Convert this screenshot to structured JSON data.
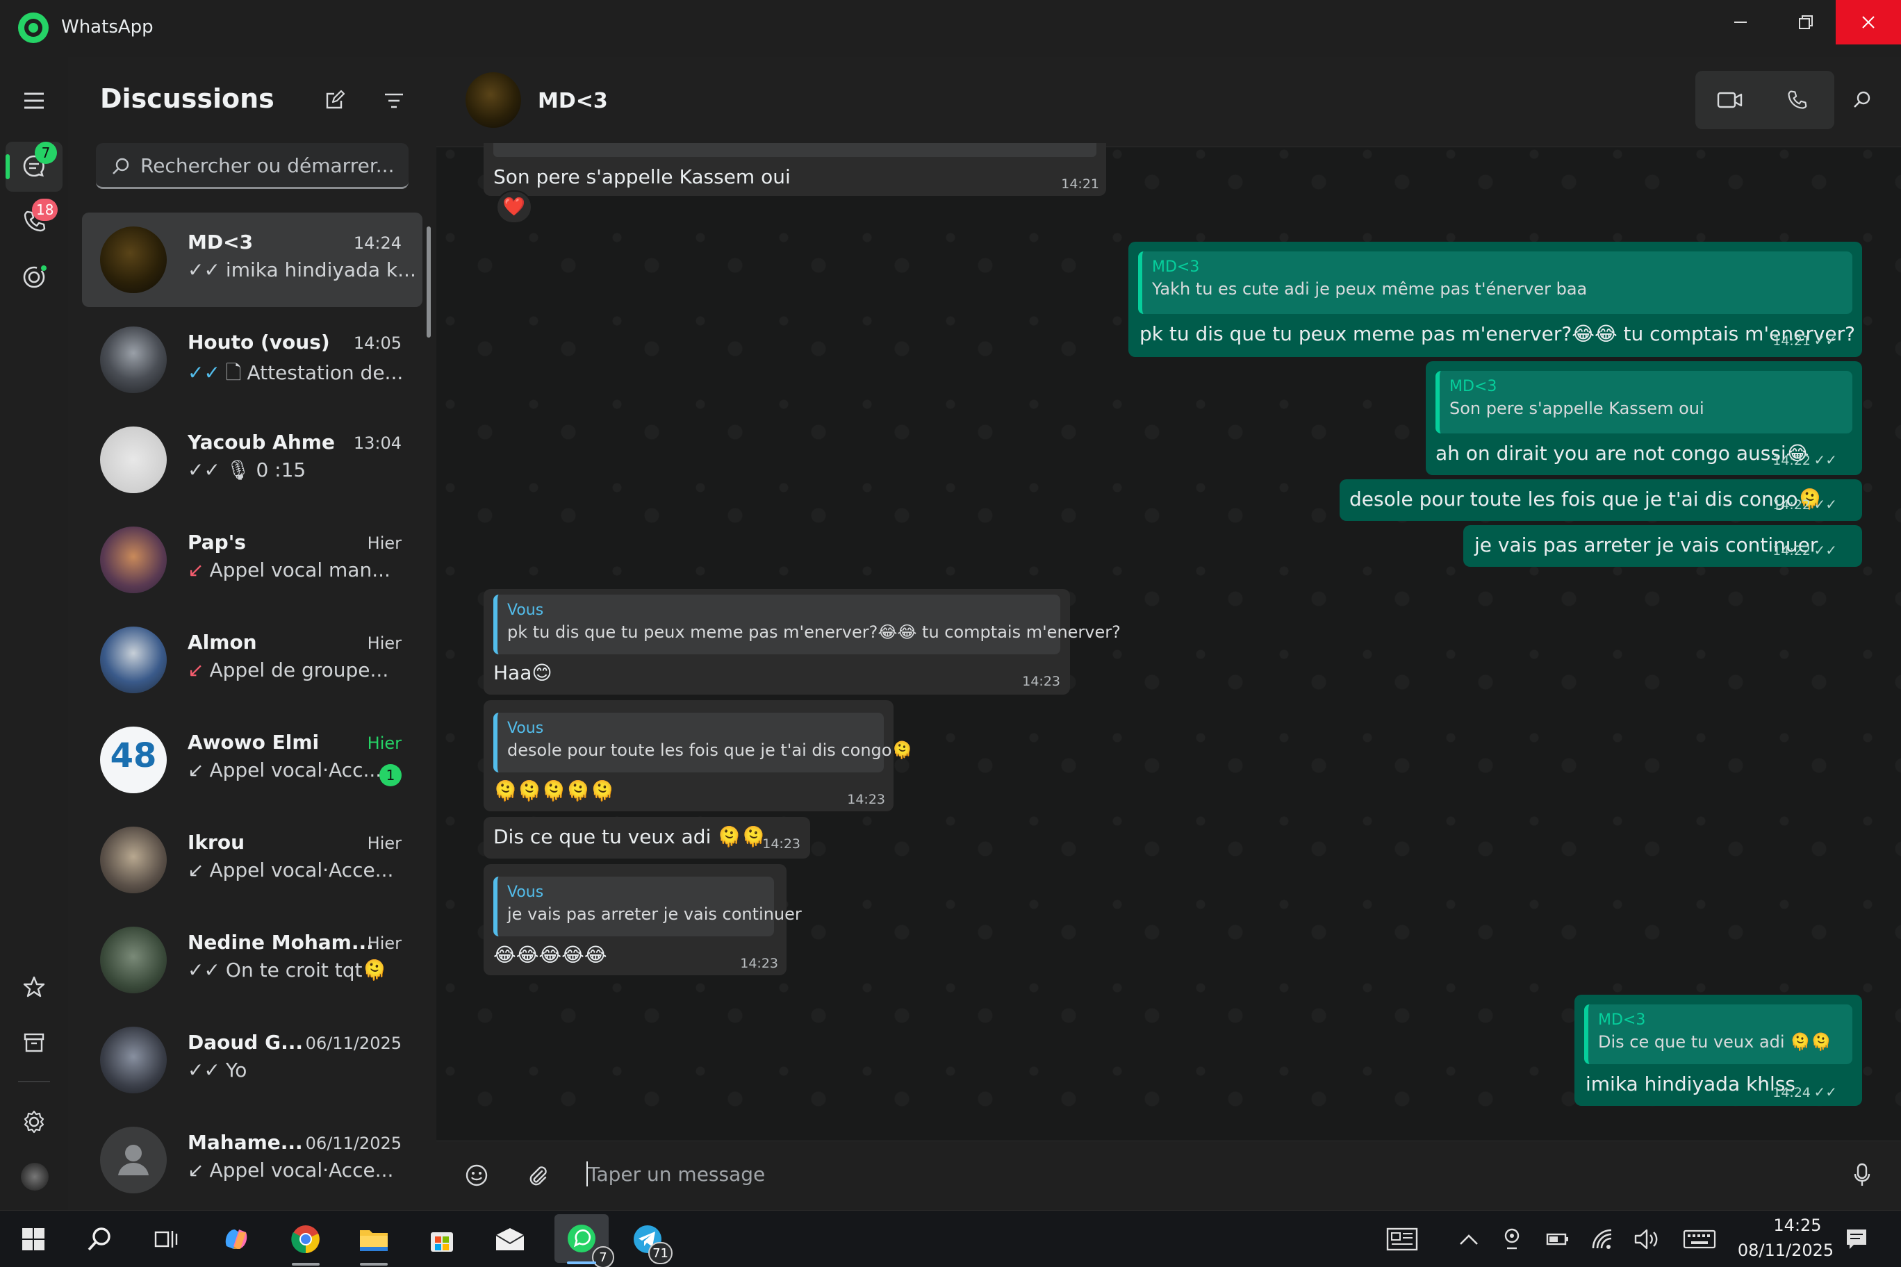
{
  "window": {
    "title": "WhatsApp"
  },
  "rail": {
    "chats_badge": "7",
    "calls_badge": "18"
  },
  "sidebar": {
    "title": "Discussions",
    "search_placeholder": "Rechercher ou démarrer...",
    "chats": [
      {
        "name": "MD<3",
        "time": "14:24",
        "status": "read",
        "preview": "imika hindiyada k..."
      },
      {
        "name": "Houto (vous)",
        "time": "14:05",
        "status": "read",
        "preview_icon": "document-icon",
        "preview": "Attestation de..."
      },
      {
        "name": "Yacoub Ahme",
        "time": "13:04",
        "status": "sent",
        "preview_icon": "mic-icon",
        "preview": "0 :15"
      },
      {
        "name": "Pap's",
        "time": "Hier",
        "preview_icon": "missed-call-icon",
        "preview": "Appel vocal man..."
      },
      {
        "name": "Almon",
        "time": "Hier",
        "preview_icon": "missed-call-icon",
        "preview": "Appel de groupe..."
      },
      {
        "name": "Awowo Elmi",
        "time": "Hier",
        "preview_icon": "incoming-call-icon",
        "preview": "Appel vocal·Acc...",
        "unread": "1"
      },
      {
        "name": "Ikrou",
        "time": "Hier",
        "preview_icon": "incoming-call-icon",
        "preview": "Appel vocal·Acce..."
      },
      {
        "name": "Nedine Moham...",
        "time": "Hier",
        "status": "sent",
        "preview": "On te croit tqt🫠"
      },
      {
        "name": "Daoud G...",
        "time": "06/11/2025",
        "status": "sent",
        "preview": "Yo"
      },
      {
        "name": "Mahame...",
        "time": "06/11/2025",
        "preview_icon": "incoming-call-icon",
        "preview": "Appel vocal·Acce..."
      }
    ]
  },
  "chat": {
    "contact_name": "MD<3",
    "messages": [
      {
        "dir": "in",
        "text": "Son pere s'appelle Kassem oui",
        "time": "14:21",
        "reaction": "❤️"
      },
      {
        "dir": "out",
        "quote_author": "MD<3",
        "quote_text": "Yakh tu es cute adi je peux même pas t'énerver baa",
        "text": "pk tu dis que tu peux meme pas m'enerver?😂😂 tu comptais m'enerver?",
        "time": "14:21"
      },
      {
        "dir": "out",
        "quote_author": "MD<3",
        "quote_text": "Son pere s'appelle Kassem oui",
        "text": "ah on dirait you are not congo aussi😂",
        "time": "14:22"
      },
      {
        "dir": "out",
        "text": "desole pour toute les fois que je t'ai dis congo🫠",
        "time": "14:22"
      },
      {
        "dir": "out",
        "text": "je vais pas arreter je vais continuer",
        "time": "14:22"
      },
      {
        "dir": "in",
        "quote_author": "Vous",
        "quote_text": "pk tu dis que tu peux meme pas m'enerver?😂😂 tu comptais m'enerver?",
        "text": "Haa😊",
        "time": "14:23"
      },
      {
        "dir": "in",
        "quote_author": "Vous",
        "quote_text": "desole pour toute les fois que je t'ai dis congo🫠",
        "text": "🫠🫠🫠🫠🫠",
        "time": "14:23"
      },
      {
        "dir": "in",
        "text": "Dis ce que tu veux adi 🫠🫠",
        "time": "14:23"
      },
      {
        "dir": "in",
        "quote_author": "Vous",
        "quote_text": "je vais pas arreter je vais continuer",
        "text": "😂😂😂😂😂",
        "time": "14:23"
      },
      {
        "dir": "out",
        "quote_author": "MD<3",
        "quote_text": "Dis ce que tu veux adi 🫠🫠",
        "text": "imika hindiyada khlss",
        "time": "14:24"
      }
    ],
    "composer_placeholder": "Taper un message"
  },
  "taskbar": {
    "whatsapp_badge": "7",
    "telegram_badge": "71",
    "clock_time": "14:25",
    "clock_date": "08/11/2025"
  },
  "colors": {
    "accent": "#25d366",
    "outgoing_bubble": "#005c4b",
    "incoming_bubble": "#2c2c2c",
    "close_button": "#e81123"
  }
}
